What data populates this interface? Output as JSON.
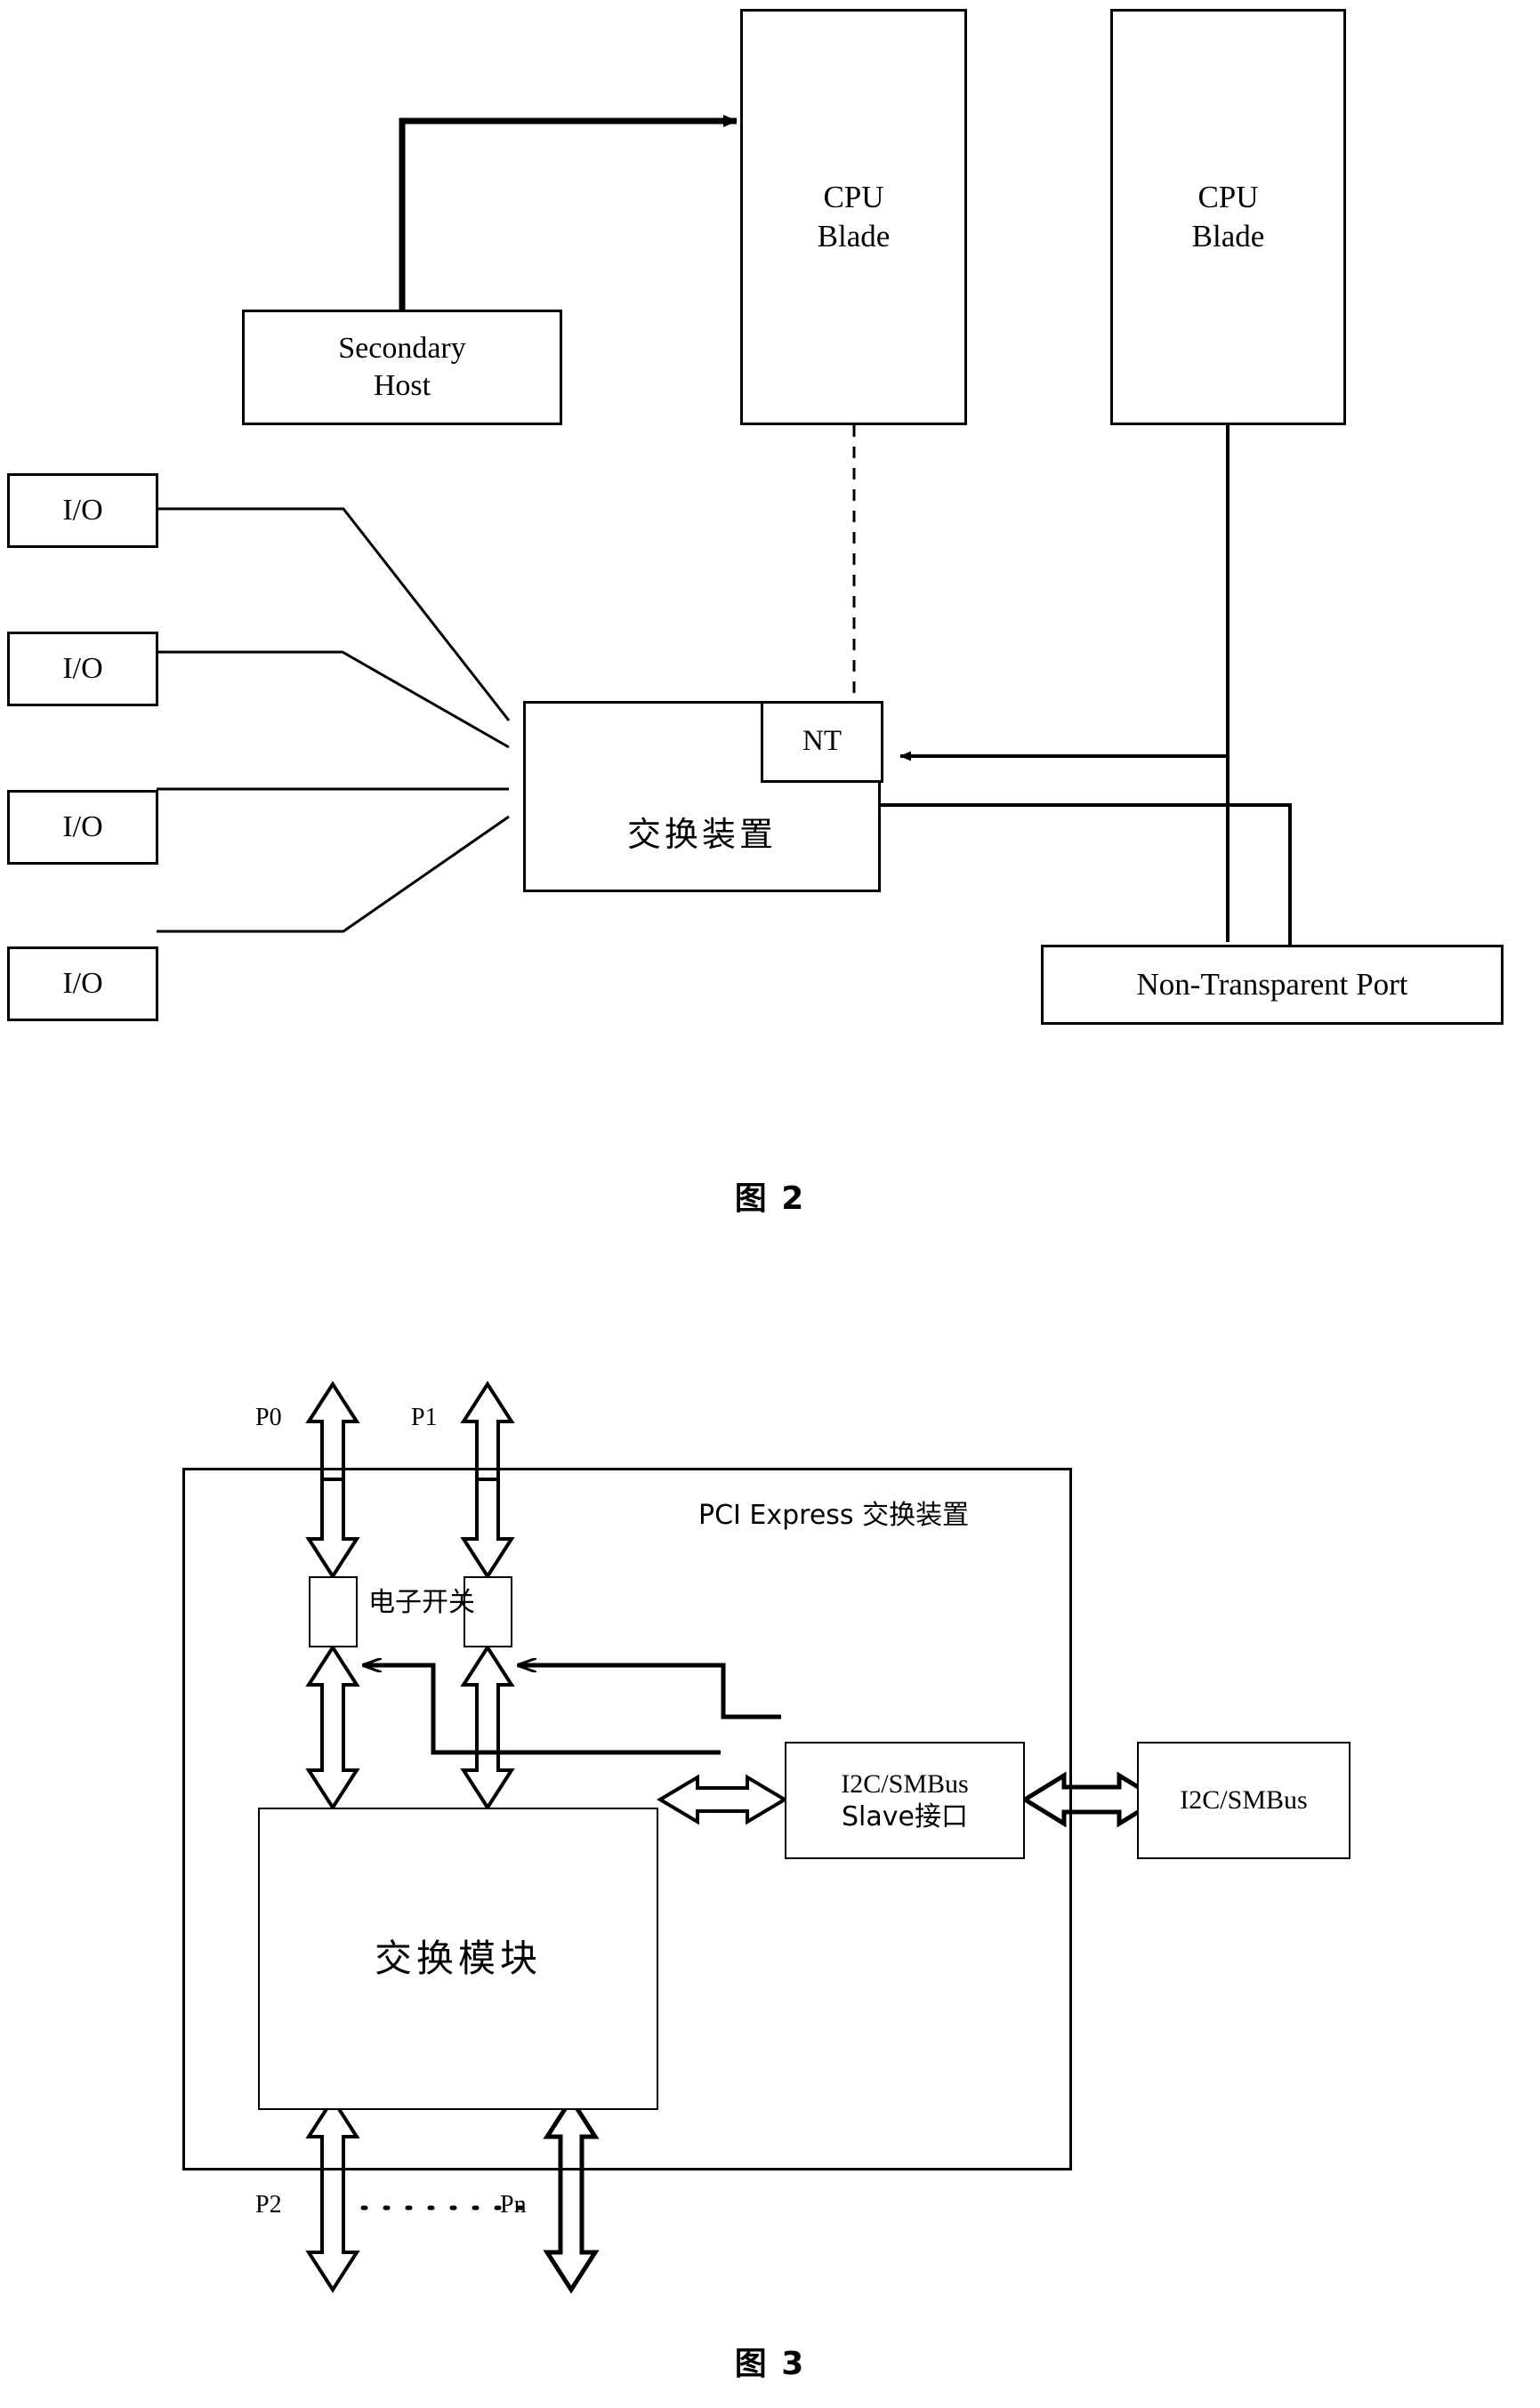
{
  "figure2": {
    "caption": "图 2",
    "nodes": {
      "secondary_host": "Secondary\nHost",
      "cpu_blade_1": "CPU\nBlade",
      "cpu_blade_2": "CPU\nBlade",
      "io_1": "I/O",
      "io_2": "I/O",
      "io_3": "I/O",
      "io_4": "I/O",
      "nt": "NT",
      "switch_device": "交换装置",
      "non_transparent_port": "Non-Transparent Port"
    },
    "io_labels": [
      "I/O",
      "I/O",
      "I/O",
      "I/O"
    ],
    "cpu_blade_labels": [
      "CPU",
      "Blade"
    ]
  },
  "figure3": {
    "caption": "图 3",
    "nodes": {
      "pci_express_switch": "PCI Express 交换装置",
      "electronic_switch_label": "电子开关",
      "switch_module": "交换模块",
      "i2c_slave_line1": "I2C/SMBus",
      "i2c_slave_line2": "Slave接口",
      "i2c_external": "I2C/SMBus"
    },
    "ports": {
      "p0": "P0",
      "p1": "P1",
      "p2": "P2",
      "pn": "Pn"
    }
  },
  "colors": {
    "line": "#000000",
    "fill": "#ffffff"
  }
}
